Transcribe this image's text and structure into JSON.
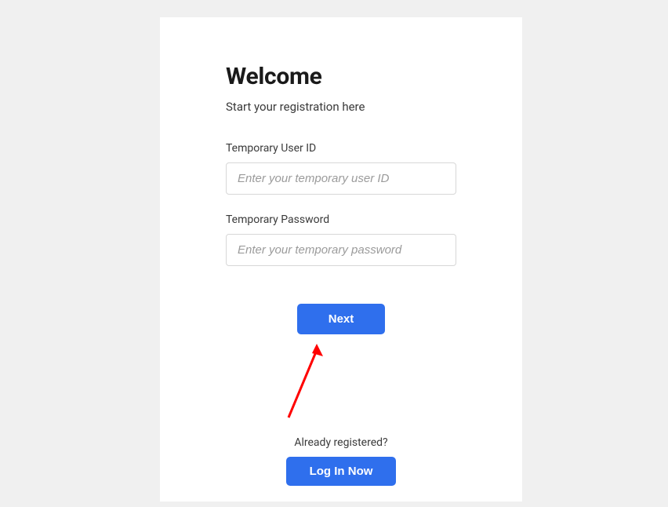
{
  "heading": "Welcome",
  "subheading": "Start your registration here",
  "fields": {
    "userId": {
      "label": "Temporary User ID",
      "placeholder": "Enter your temporary user ID"
    },
    "password": {
      "label": "Temporary Password",
      "placeholder": "Enter your temporary password"
    }
  },
  "buttons": {
    "next": "Next",
    "login": "Log In Now"
  },
  "footer": {
    "text": "Already registered?"
  },
  "colors": {
    "primary": "#2f6fed",
    "annotation": "#ff0000"
  }
}
